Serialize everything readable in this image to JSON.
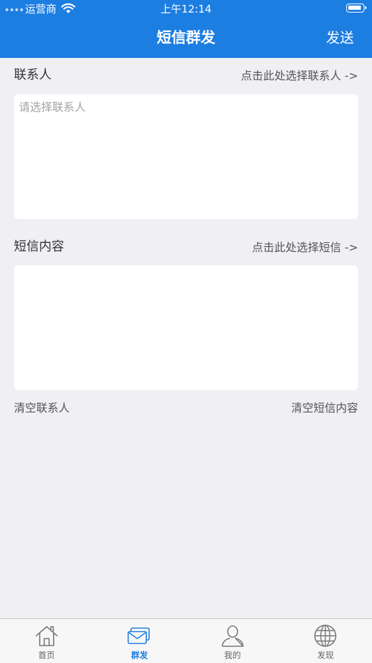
{
  "status_bar": {
    "carrier": "运营商",
    "time": "上午12:14"
  },
  "nav": {
    "title": "短信群发",
    "send_label": "发送"
  },
  "contacts": {
    "label": "联系人",
    "select_link": "点击此处选择联系人 ->",
    "placeholder": "请选择联系人"
  },
  "message": {
    "label": "短信内容",
    "select_link": "点击此处选择短信 ->",
    "placeholder": ""
  },
  "actions": {
    "clear_contacts": "清空联系人",
    "clear_message": "清空短信内容"
  },
  "tabs": [
    {
      "label": "首页",
      "icon": "home-icon",
      "active": false
    },
    {
      "label": "群发",
      "icon": "envelope-icon",
      "active": true
    },
    {
      "label": "我的",
      "icon": "user-icon",
      "active": false
    },
    {
      "label": "发现",
      "icon": "globe-icon",
      "active": false
    }
  ],
  "colors": {
    "accent": "#1d7ee2",
    "background": "#efeff4",
    "tab_inactive": "#666666"
  }
}
